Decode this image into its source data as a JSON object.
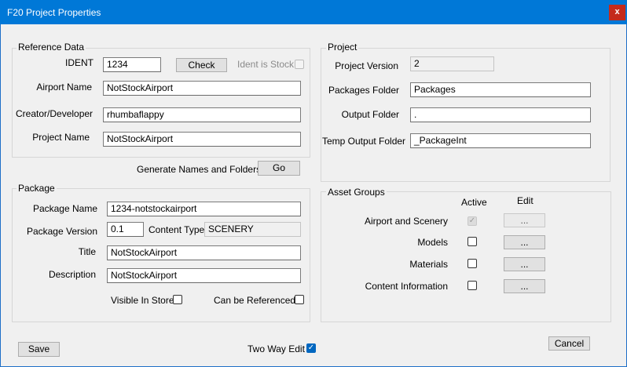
{
  "window": {
    "title": "F20 Project Properties",
    "close_label": "x"
  },
  "reference": {
    "legend": "Reference Data",
    "ident_label": "IDENT",
    "ident_value": "1234",
    "check_label": "Check",
    "ident_stock_label": "Ident is Stock",
    "airport_label": "Airport Name",
    "airport_value": "NotStockAirport",
    "creator_label": "Creator/Developer",
    "creator_value": "rhumbaflappy",
    "project_name_label": "Project Name",
    "project_name_value": "NotStockAirport"
  },
  "generate": {
    "label": "Generate Names and Folders",
    "go_label": "Go"
  },
  "project": {
    "legend": "Project",
    "version_label": "Project Version",
    "version_value": "2",
    "packages_label": "Packages Folder",
    "packages_value": "Packages",
    "output_label": "Output Folder",
    "output_value": ".",
    "temp_label": "Temp Output Folder",
    "temp_value": "_PackageInt"
  },
  "package": {
    "legend": "Package",
    "name_label": "Package Name",
    "name_value": "1234-notstockairport",
    "version_label": "Package Version",
    "version_value": "0.1",
    "content_type_label": "Content Type",
    "content_type_value": "SCENERY",
    "title_label": "Title",
    "title_value": "NotStockAirport",
    "description_label": "Description",
    "description_value": "NotStockAirport",
    "visible_label": "Visible In Store",
    "referenced_label": "Can be Referenced"
  },
  "asset_groups": {
    "legend": "Asset Groups",
    "active_header": "Active",
    "edit_header": "Edit",
    "rows": [
      {
        "label": "Airport and Scenery",
        "edit_label": "..."
      },
      {
        "label": "Models",
        "edit_label": "..."
      },
      {
        "label": "Materials",
        "edit_label": "..."
      },
      {
        "label": "Content Information",
        "edit_label": "..."
      }
    ]
  },
  "footer": {
    "save_label": "Save",
    "two_way_label": "Two Way Edit",
    "cancel_label": "Cancel"
  },
  "colors": {
    "titlebar": "#0078d7",
    "close": "#c42b1c",
    "checkbox_on": "#0067c0"
  }
}
